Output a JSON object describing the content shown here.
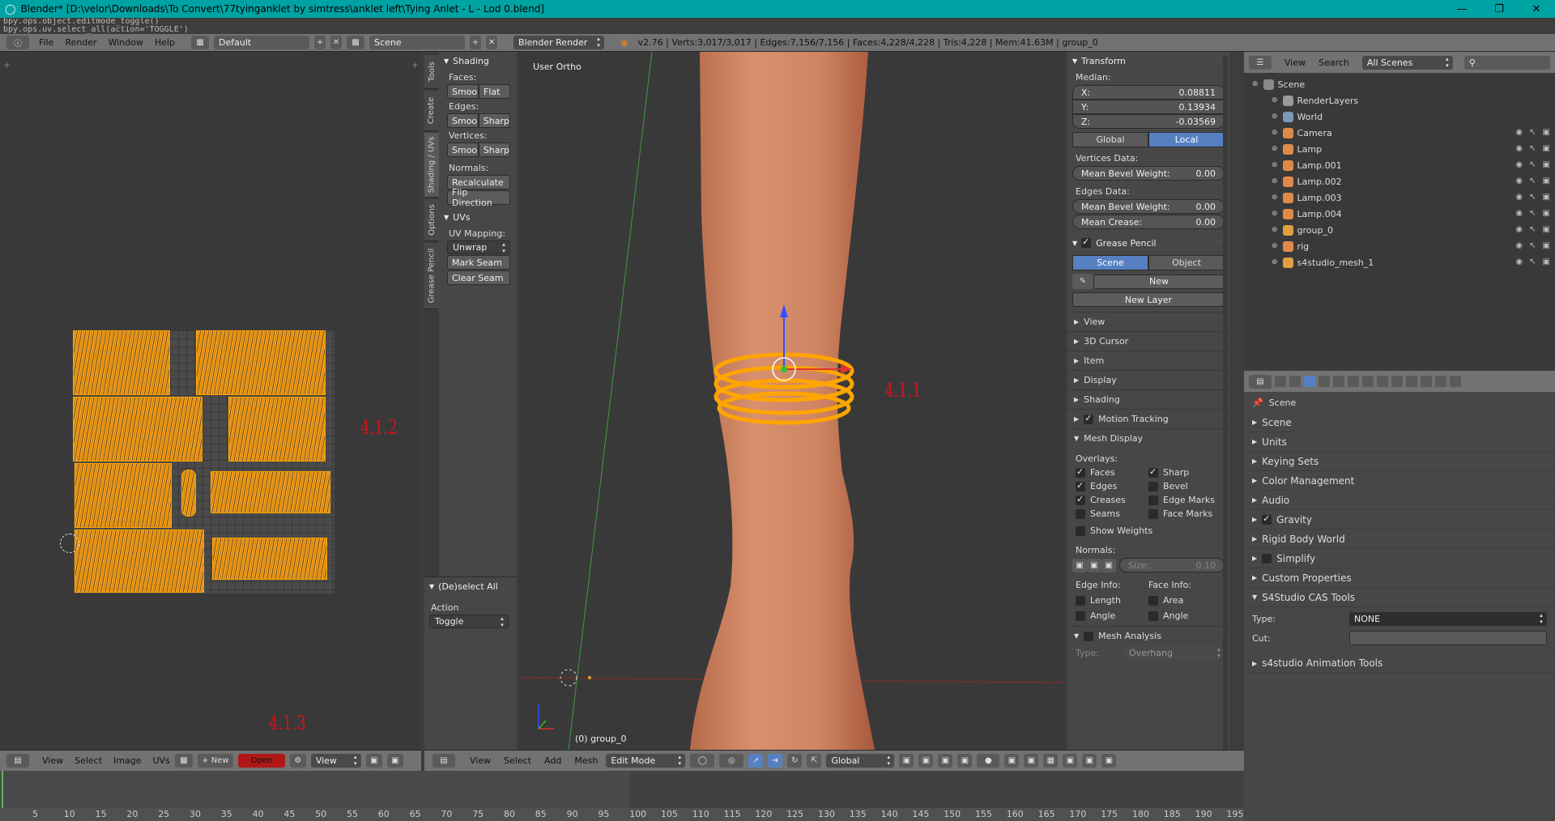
{
  "window": {
    "title": "Blender* [D:\\velor\\Downloads\\To Convert\\77tyinganklet by simtress\\anklet left\\Tying Anlet - L - Lod 0.blend]",
    "controls": [
      "—",
      "❐",
      "✕"
    ]
  },
  "console": {
    "lines": [
      "bpy.ops.object.editmode_toggle()",
      "bpy.ops.uv.select_all(action='TOGGLE')"
    ]
  },
  "infobar": {
    "menus": [
      "File",
      "Render",
      "Window",
      "Help"
    ],
    "layout": "Default",
    "scene": "Scene",
    "engine": "Blender Render",
    "stats": "v2.76 | Verts:3,017/3,017 | Edges:7,156/7,156 | Faces:4,228/4,228 | Tris:4,228 | Mem:41.63M | group_0"
  },
  "labels": {
    "uv": "4.1.2",
    "viewport": "4.1.1",
    "bottom": "4.1.3"
  },
  "tabs": [
    "Tools",
    "Create",
    "Shading / UVs",
    "Options",
    "Grease Pencil"
  ],
  "toolshelf": {
    "shading": {
      "title": "Shading",
      "faces": "Faces:",
      "edges": "Edges:",
      "vertices": "Vertices:",
      "normals": "Normals:",
      "smooth": "Smoo",
      "flat": "Flat",
      "sharp": "Sharp",
      "recalculate": "Recalculate",
      "flip": "Flip Direction"
    },
    "uvs": {
      "title": "UVs",
      "mapping": "UV Mapping:",
      "unwrap": "Unwrap",
      "mark": "Mark Seam",
      "clear": "Clear Seam"
    },
    "operator": {
      "title": "(De)select All",
      "action": "Action",
      "value": "Toggle"
    }
  },
  "viewport": {
    "view_name": "User Ortho",
    "object_label": "(0) group_0"
  },
  "npanel": {
    "transform": {
      "title": "Transform",
      "median": "Median:",
      "x_label": "X:",
      "x": "0.08811",
      "y_label": "Y:",
      "y": "0.13934",
      "z_label": "Z:",
      "z": "-0.03569",
      "global": "Global",
      "local": "Local",
      "vdata": "Vertices Data:",
      "bevel_label": "Mean Bevel Weight:",
      "v_bevel": "0.00",
      "edata": "Edges Data:",
      "e_bevel": "0.00",
      "crease_label": "Mean Crease:",
      "crease": "0.00"
    },
    "grease": {
      "title": "Grease Pencil",
      "scene": "Scene",
      "object": "Object",
      "new": "New",
      "new_layer": "New Layer"
    },
    "collapsed": [
      "View",
      "3D Cursor",
      "Item",
      "Display",
      "Shading"
    ],
    "motion": "Motion Tracking",
    "mesh_display": {
      "title": "Mesh Display",
      "overlays": "Overlays:",
      "faces": "Faces",
      "sharp": "Sharp",
      "edges": "Edges",
      "bevel": "Bevel",
      "creases": "Creases",
      "edge_marks": "Edge Marks",
      "seams": "Seams",
      "face_marks": "Face Marks",
      "show_weights": "Show Weights",
      "normals": "Normals:",
      "size": "Size:",
      "size_val": "0.10",
      "edge_info": "Edge Info:",
      "face_info": "Face Info:",
      "length": "Length",
      "angle": "Angle",
      "area": "Area",
      "angle2": "Angle"
    },
    "analysis": {
      "title": "Mesh Analysis",
      "type_label": "Type:",
      "type": "Overhang"
    }
  },
  "outliner": {
    "menus": [
      "View",
      "Search"
    ],
    "filter": "All Scenes",
    "items": [
      {
        "name": "Scene",
        "indent": 0,
        "color": "#8a8a8a"
      },
      {
        "name": "RenderLayers",
        "indent": 1,
        "color": "#9a9a9a"
      },
      {
        "name": "World",
        "indent": 1,
        "color": "#7a9ab5"
      },
      {
        "name": "Camera",
        "indent": 1,
        "color": "#e08a4a"
      },
      {
        "name": "Lamp",
        "indent": 1,
        "color": "#e08a4a"
      },
      {
        "name": "Lamp.001",
        "indent": 1,
        "color": "#e08a4a"
      },
      {
        "name": "Lamp.002",
        "indent": 1,
        "color": "#e08a4a"
      },
      {
        "name": "Lamp.003",
        "indent": 1,
        "color": "#e08a4a"
      },
      {
        "name": "Lamp.004",
        "indent": 1,
        "color": "#e08a4a"
      },
      {
        "name": "group_0",
        "indent": 1,
        "color": "#e0a040"
      },
      {
        "name": "rig",
        "indent": 1,
        "color": "#e08a4a"
      },
      {
        "name": "s4studio_mesh_1",
        "indent": 1,
        "color": "#e0a040"
      }
    ]
  },
  "props": {
    "breadcrumb": "Scene",
    "sections": [
      "Scene",
      "Units",
      "Keying Sets",
      "Color Management",
      "Audio",
      "Gravity",
      "Rigid Body World",
      "Simplify",
      "Custom Properties",
      "S4Studio CAS Tools"
    ],
    "type_label": "Type:",
    "type": "NONE",
    "cut_label": "Cut:",
    "anim": "s4studio Animation Tools"
  },
  "uv_header": {
    "menus": [
      "View",
      "Select",
      "Image",
      "UVs"
    ],
    "new": "New",
    "open": "Open",
    "view": "View"
  },
  "view3d_header": {
    "menus": [
      "View",
      "Select",
      "Add",
      "Mesh"
    ],
    "mode": "Edit Mode",
    "orientation": "Global"
  },
  "timeline": {
    "ticks": [
      "5",
      "10",
      "15",
      "20",
      "25",
      "30",
      "35",
      "40",
      "45",
      "50",
      "55",
      "60",
      "65",
      "70",
      "75",
      "80",
      "85",
      "90",
      "95",
      "100",
      "105",
      "110",
      "115",
      "120",
      "125",
      "130",
      "135",
      "140",
      "145",
      "150",
      "155",
      "160",
      "165",
      "170",
      "175",
      "180",
      "185",
      "190",
      "195"
    ]
  }
}
